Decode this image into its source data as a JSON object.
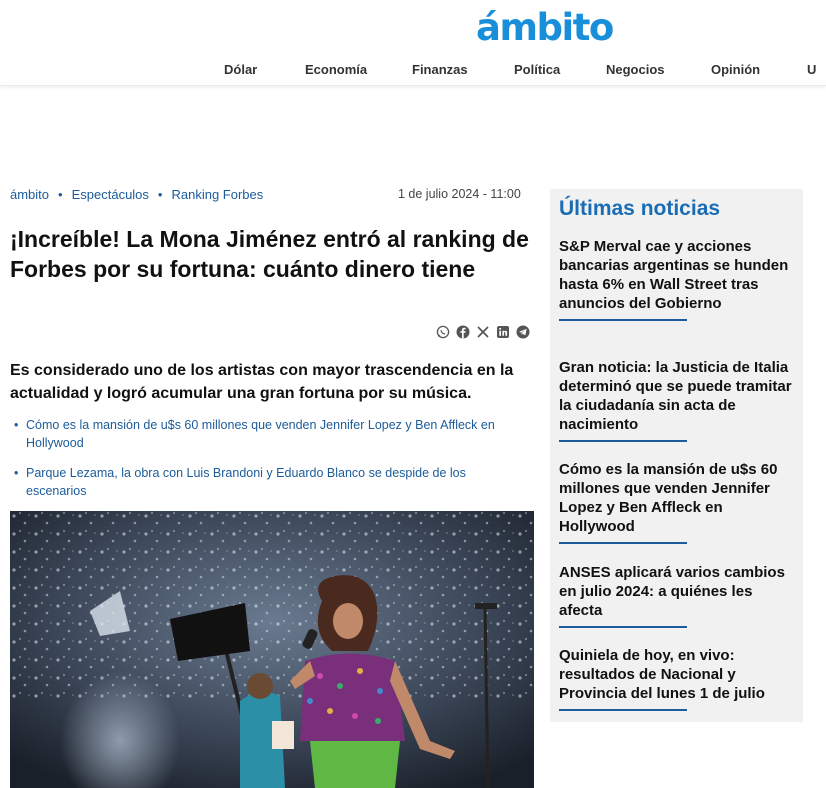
{
  "header": {
    "logo": "ámbito",
    "nav": [
      "Dólar",
      "Economía",
      "Finanzas",
      "Política",
      "Negocios",
      "Opinión",
      "U"
    ]
  },
  "article": {
    "breadcrumb": [
      "ámbito",
      "Espectáculos",
      "Ranking Forbes"
    ],
    "breadcrumb_separator": "•",
    "date": "1 de julio 2024 - 11:00",
    "title": "¡Increíble! La Mona Jiménez entró al ranking de Forbes por su fortuna: cuánto dinero tiene",
    "share_icons": [
      "whatsapp-icon",
      "facebook-icon",
      "x-icon",
      "linkedin-icon",
      "telegram-icon"
    ],
    "lead": "Es considerado uno de los artistas con mayor trascendencia en la actualidad y logró acumular una gran fortuna por su música.",
    "related": [
      "Cómo es la mansión de u$s 60 millones que venden Jennifer Lopez y Ben Affleck en Hollywood",
      "Parque Lezama, la obra con Luis Brandoni y Eduardo Blanco se despide de los escenarios"
    ]
  },
  "sidebar": {
    "title": "Últimas noticias",
    "items": [
      "S&P Merval cae y acciones bancarias argentinas se hunden hasta 6% en Wall Street tras anuncios del Gobierno",
      "Gran noticia: la Justicia de Italia determinó que se puede tramitar la ciudadanía sin acta de nacimiento",
      "Cómo es la mansión de u$s 60 millones que venden Jennifer Lopez y Ben Affleck en Hollywood",
      "ANSES aplicará varios cambios en julio 2024: a quiénes les afecta",
      "Quiniela de hoy, en vivo: resultados de Nacional y Provincia del lunes 1 de julio"
    ]
  },
  "colors": {
    "brand": "#1a8fd9",
    "link": "#1c5c9a",
    "sidebar_title": "#1a6db4",
    "sidebar_bg": "#f1f1f1"
  }
}
